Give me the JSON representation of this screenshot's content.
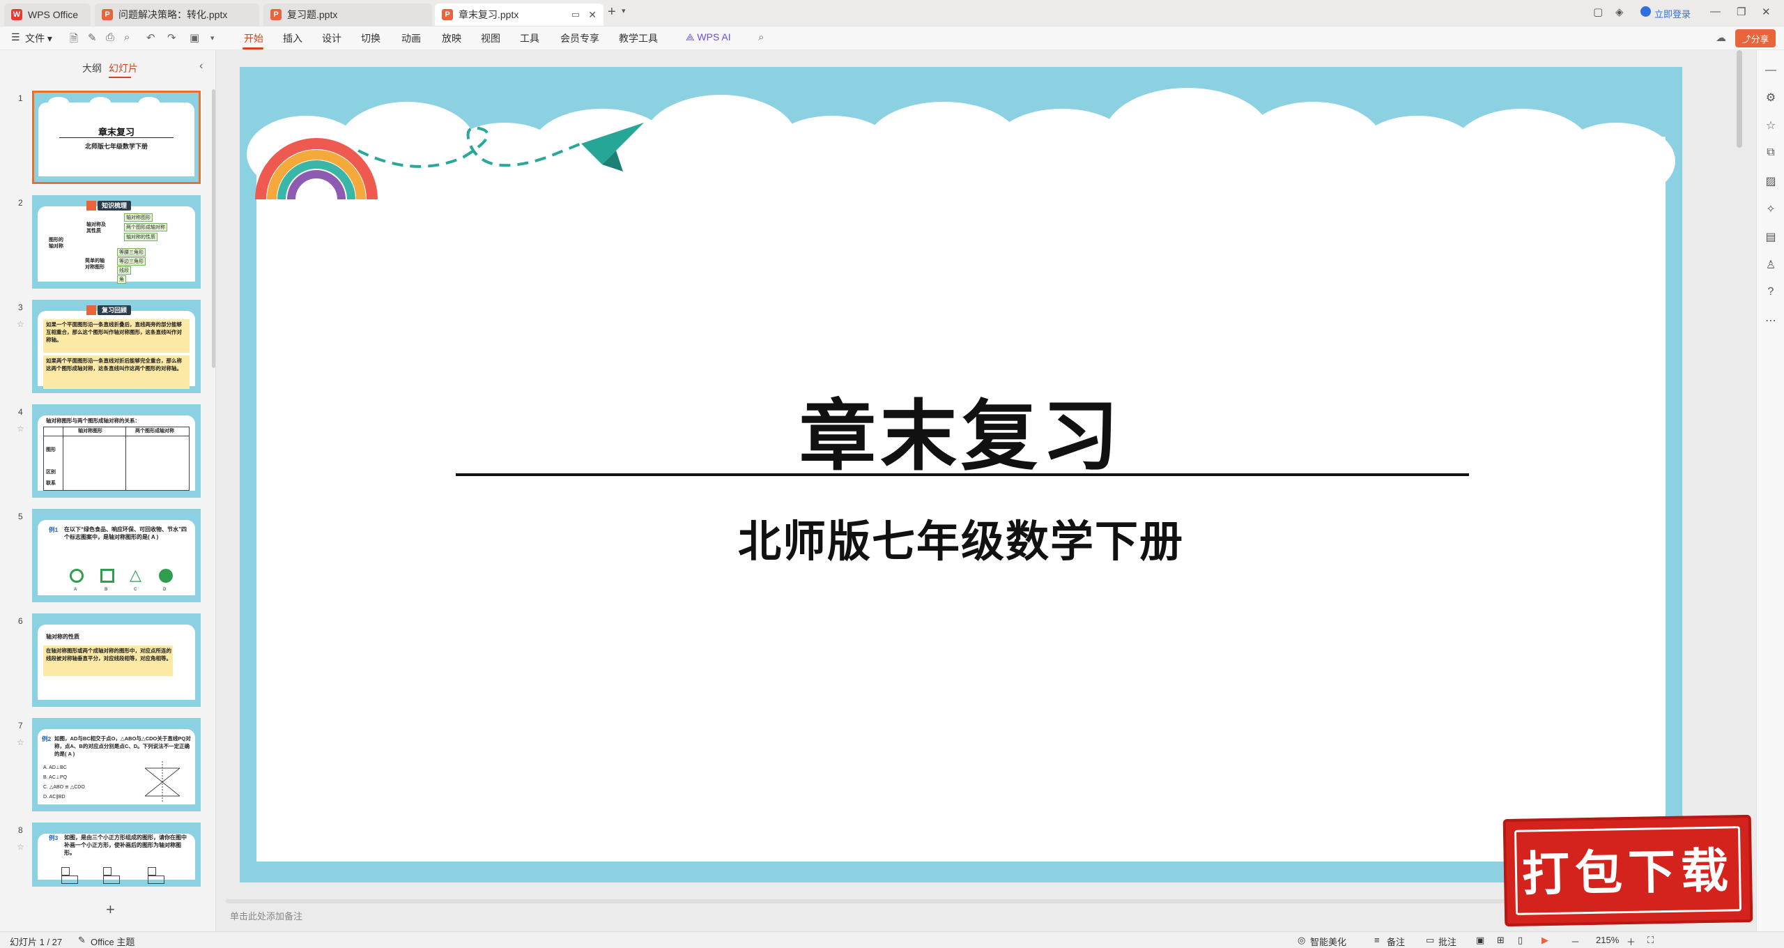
{
  "titlebar": {
    "tabs": [
      {
        "label": "WPS Office",
        "icon": "wps-logo-icon"
      },
      {
        "label": "问题解决策略：转化.pptx",
        "icon": "ppt-file-icon"
      },
      {
        "label": "复习题.pptx",
        "icon": "ppt-file-icon"
      },
      {
        "label": "章末复习.pptx",
        "icon": "ppt-file-icon"
      }
    ],
    "new_tab": "+",
    "login_label": "立即登录"
  },
  "ribbon": {
    "file_label": "文件",
    "menus": [
      "开始",
      "插入",
      "设计",
      "切换",
      "动画",
      "放映",
      "视图",
      "工具",
      "会员专享",
      "教学工具"
    ],
    "active_menu": "开始",
    "ai_label": "WPS AI",
    "share_label": "分享"
  },
  "left_panel": {
    "tabs": [
      "大纲",
      "幻灯片"
    ],
    "active_tab": "幻灯片",
    "slides": [
      {
        "num": "1",
        "title": "章末复习",
        "subtitle": "北师版七年级数学下册"
      },
      {
        "num": "2",
        "header": "知识梳理",
        "nodes": [
          "图形的轴对称",
          "轴对称及其性质",
          "简单的轴对称图形",
          "轴对称图形",
          "两个图形成轴对称",
          "轴对称的性质",
          "等腰三角形",
          "等边三角形",
          "线段",
          "角"
        ]
      },
      {
        "num": "3",
        "header": "复习回顾",
        "p1": "如果一个平面图形沿一条直线折叠后，直线两旁的部分能够互相重合，那么这个图形叫作轴对称图形，这条直线叫作对称轴。",
        "p2": "如果两个平面图形沿一条直线对折后能够完全重合，那么称这两个图形成轴对称，这条直线叫作这两个图形的对称轴。"
      },
      {
        "num": "4",
        "title": "轴对称图形与两个图形成轴对称的关系：",
        "col1": "轴对称图形",
        "col2": "两个图形成轴对称",
        "row1": "图形",
        "row2": "区别",
        "row3": "联系"
      },
      {
        "num": "5",
        "label": "例1",
        "text": "在以下“绿色食品、响应环保、可回收物、节水”四个标志图案中，是轴对称图形的是( A )",
        "options": [
          "A",
          "B",
          "C",
          "D"
        ]
      },
      {
        "num": "6",
        "title": "轴对称的性质",
        "text": "在轴对称图形或两个成轴对称的图形中，对应点所连的线段被对称轴垂直平分，对应线段相等，对应角相等。"
      },
      {
        "num": "7",
        "label": "例2",
        "text": "如图，AD与BC相交于点O，△ABO与△CDO关于直线PQ对称，点A、B的对应点分别是点C、D。下列说法不一定正确的是( A )",
        "options": [
          "A. AD⊥BC",
          "B. AC⊥PQ",
          "C. △ABO ≌ △CDO",
          "D. AC∥BD"
        ]
      },
      {
        "num": "8",
        "label": "例3",
        "text": "如图，是由三个小正方形组成的图形，请你在图中补画一个小正方形，使补画后的图形为轴对称图形。"
      }
    ],
    "add_slide": "+"
  },
  "slide": {
    "title": "章末复习",
    "subtitle": "北师版七年级数学下册"
  },
  "notes_placeholder": "单击此处添加备注",
  "statusbar": {
    "slide_info": "幻灯片 1 / 27",
    "theme": "Office 主题",
    "beautify": "智能美化",
    "notes": "备注",
    "comments": "批注",
    "zoom": "215%"
  },
  "stamp": {
    "text": "打包下载"
  },
  "colors": {
    "accent": "#d4441f",
    "sky": "#8bd1e2",
    "stamp": "#d3231c"
  }
}
